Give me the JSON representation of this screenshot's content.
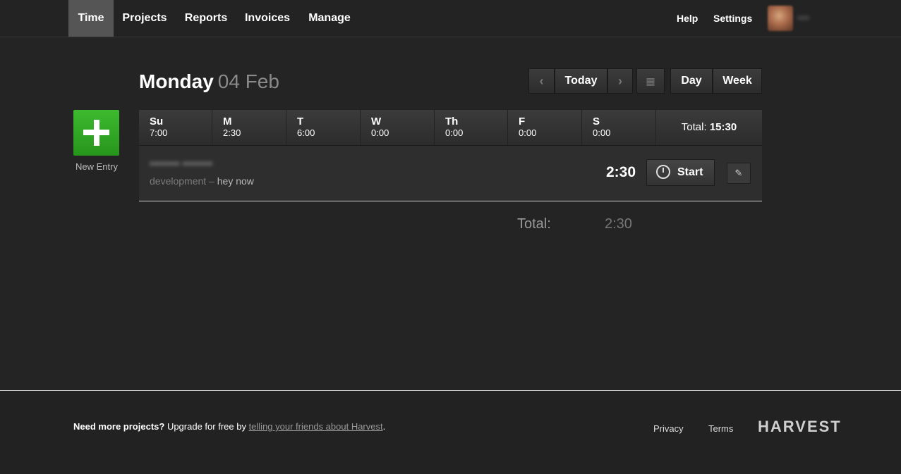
{
  "nav": {
    "items": [
      {
        "label": "Time",
        "active": true
      },
      {
        "label": "Projects"
      },
      {
        "label": "Reports"
      },
      {
        "label": "Invoices"
      },
      {
        "label": "Manage"
      }
    ],
    "help": "Help",
    "settings": "Settings"
  },
  "header": {
    "day": "Monday",
    "date": "04 Feb",
    "prev_icon": "chevron-left-icon",
    "today_label": "Today",
    "next_icon": "chevron-right-icon",
    "calendar_icon": "calendar-icon",
    "day_label": "Day",
    "week_label": "Week"
  },
  "new_entry": {
    "icon": "plus-icon",
    "label": "New Entry"
  },
  "week": {
    "days": [
      {
        "name": "Su",
        "hours": "7:00"
      },
      {
        "name": "M",
        "hours": "2:30"
      },
      {
        "name": "T",
        "hours": "6:00"
      },
      {
        "name": "W",
        "hours": "0:00"
      },
      {
        "name": "Th",
        "hours": "0:00"
      },
      {
        "name": "F",
        "hours": "0:00"
      },
      {
        "name": "S",
        "hours": "0:00"
      }
    ],
    "total_label": "Total:",
    "total_value": "15:30"
  },
  "entry": {
    "task": "development",
    "separator": "–",
    "notes": "hey now",
    "hours": "2:30",
    "start_label": "Start",
    "edit_icon": "pencil-icon"
  },
  "day_total": {
    "label": "Total:",
    "value": "2:30"
  },
  "footer": {
    "promo_bold": "Need more projects?",
    "promo_text": " Upgrade for free by ",
    "promo_link": "telling your friends about Harvest",
    "promo_end": ".",
    "privacy": "Privacy",
    "terms": "Terms",
    "logo": "HARVEST"
  },
  "colors": {
    "background": "#242424",
    "accent_green": "#2fa524",
    "active_nav": "#555555"
  }
}
